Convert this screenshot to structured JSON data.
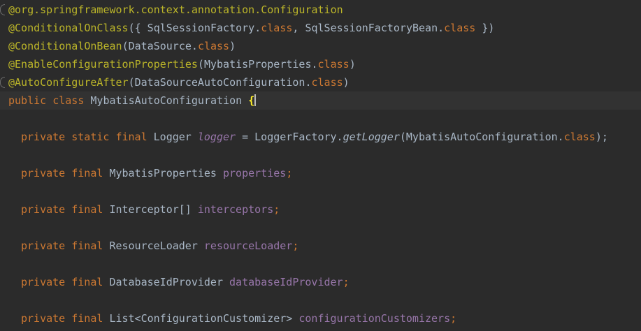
{
  "colors": {
    "background": "#2b2b2b",
    "current_line": "#323232",
    "annotation": "#bbb529",
    "keyword": "#cc7832",
    "plain": "#a9b7c6",
    "field": "#9876aa",
    "brace_match": "#ffef28"
  },
  "icons": {
    "gutter_fold": "fold-marker-icon"
  },
  "editor": {
    "lines": [
      {
        "parts": [
          "@org.springframework.context.annotation.",
          "Configuration"
        ]
      },
      {
        "parts": [
          "@ConditionalOnClass",
          "({ SqlSessionFactory.",
          "class",
          ", SqlSessionFactoryBean.",
          "class",
          " })"
        ]
      },
      {
        "parts": [
          "@ConditionalOnBean",
          "(DataSource.",
          "class",
          ")"
        ]
      },
      {
        "parts": [
          "@EnableConfigurationProperties",
          "(MybatisProperties.",
          "class",
          ")"
        ]
      },
      {
        "parts": [
          "@AutoConfigureAfter",
          "(DataSourceAutoConfiguration.",
          "class",
          ")"
        ]
      },
      {
        "parts": [
          "public class ",
          "MybatisAutoConfiguration ",
          "{"
        ]
      },
      {
        "parts": []
      },
      {
        "parts": [
          "private static final ",
          "Logger ",
          "logger",
          " = LoggerFactory.",
          "getLogger",
          "(MybatisAutoConfiguration.",
          "class",
          ");"
        ]
      },
      {
        "parts": []
      },
      {
        "parts": [
          "private final ",
          "MybatisProperties ",
          "properties",
          ";"
        ]
      },
      {
        "parts": []
      },
      {
        "parts": [
          "private final ",
          "Interceptor[] ",
          "interceptors",
          ";"
        ]
      },
      {
        "parts": []
      },
      {
        "parts": [
          "private final ",
          "ResourceLoader ",
          "resourceLoader",
          ";"
        ]
      },
      {
        "parts": []
      },
      {
        "parts": [
          "private final ",
          "DatabaseIdProvider ",
          "databaseIdProvider",
          ";"
        ]
      },
      {
        "parts": []
      },
      {
        "parts": [
          "private final ",
          "List<ConfigurationCustomizer> ",
          "configurationCustomizers",
          ";"
        ]
      }
    ]
  }
}
